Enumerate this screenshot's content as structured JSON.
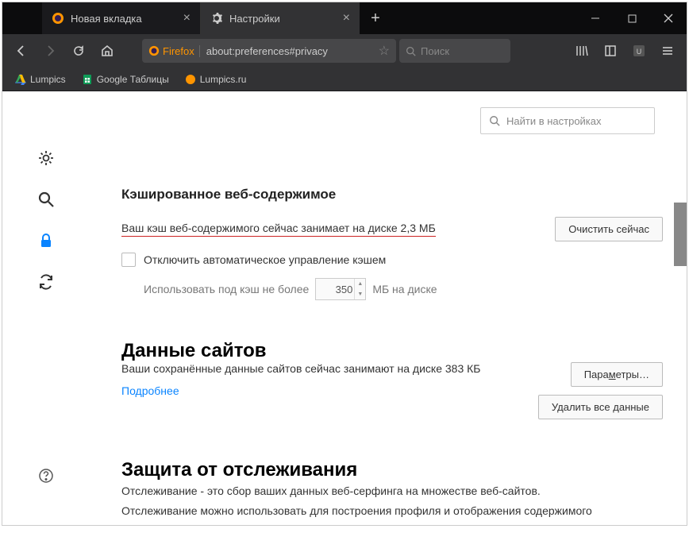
{
  "tabs": {
    "inactive": {
      "label": "Новая вкладка"
    },
    "active": {
      "label": "Настройки"
    }
  },
  "urlbar": {
    "identity": "Firefox",
    "url": "about:preferences#privacy"
  },
  "searchbar": {
    "placeholder": "Поиск"
  },
  "bookmarks": {
    "items": [
      {
        "label": "Lumpics"
      },
      {
        "label": "Google Таблицы"
      },
      {
        "label": "Lumpics.ru"
      }
    ]
  },
  "settings_search": {
    "placeholder": "Найти в настройках"
  },
  "cache": {
    "heading": "Кэшированное веб-содержимое",
    "status": "Ваш кэш веб-содержимого сейчас занимает на диске 2,3 МБ",
    "clear_btn": "Очистить сейчас",
    "checkbox_label": "Отключить автоматическое управление кэшем",
    "limit_prefix": "Использовать под кэш не более",
    "limit_value": "350",
    "limit_suffix": "МБ на диске"
  },
  "site_data": {
    "heading": "Данные сайтов",
    "status": "Ваши сохранённые данные сайтов сейчас занимают на диске 383 КБ",
    "more_link": "Подробнее",
    "params_btn_pre": "Пара",
    "params_btn_key": "м",
    "params_btn_post": "етры…",
    "delete_btn": "Удалить все данные"
  },
  "tracking": {
    "heading": "Защита от отслеживания",
    "desc1": "Отслеживание - это сбор ваших данных веб-серфинга на множестве веб-сайтов.",
    "desc2": "Отслеживание можно использовать для построения профиля и отображения содержимого"
  }
}
